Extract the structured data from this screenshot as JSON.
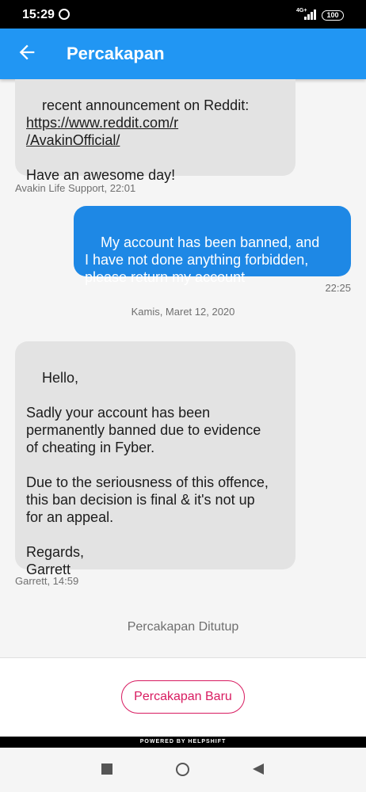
{
  "status_bar": {
    "time": "15:29",
    "network": "4G+",
    "battery": "100"
  },
  "app_bar": {
    "title": "Percakapan"
  },
  "messages": [
    {
      "direction": "in",
      "text": "recent announcement on Reddit:\n",
      "link": "https://www.reddit.com/r\n/AvakinOfficial/",
      "text_after": "\n\nHave an awesome day!",
      "meta": "Avakin Life Support, 22:01"
    },
    {
      "direction": "out",
      "text": "My account has been banned, and\nI have not done anything forbidden,\nplease return my account",
      "meta": "22:25"
    },
    {
      "direction": "in",
      "text": "Hello,\n\nSadly your account has been\npermanently banned due to evidence\nof cheating in Fyber.\n\nDue to the seriousness of this offence,\nthis ban decision is final & it's not up\nfor an appeal.\n\nRegards,\nGarrett",
      "meta": "Garrett, 14:59"
    }
  ],
  "date_separator": "Kamis, Maret 12, 2020",
  "conversation_closed": "Percakapan Ditutup",
  "new_conversation_button": "Percakapan Baru",
  "powered_by": "POWERED BY HELPSHIFT",
  "colors": {
    "app_bar": "#2196f3",
    "outgoing_bubble": "#1e88e5",
    "incoming_bubble": "#e3e3e3",
    "accent_button": "#d81b60"
  }
}
